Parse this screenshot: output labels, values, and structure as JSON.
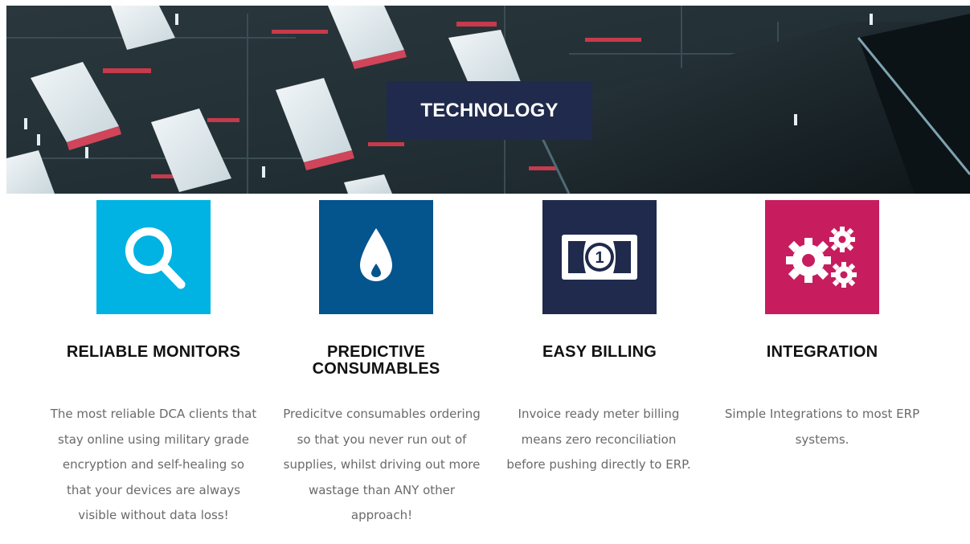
{
  "hero": {
    "title": "TECHNOLOGY"
  },
  "features": [
    {
      "title": "RELIABLE MONITORS",
      "icon": "search-icon",
      "color": "#00b3e3",
      "description": "The most reliable DCA clients that stay online using military grade encryption and self-healing so that your devices are always visible without data loss!"
    },
    {
      "title": "PREDICTIVE CONSUMABLES",
      "icon": "ink-drop-icon",
      "color": "#04548d",
      "description": "Predicitve consumables ordering so that you never run out of supplies, whilst driving out more wastage than ANY other approach!"
    },
    {
      "title": "EASY BILLING",
      "icon": "banknote-icon",
      "color": "#1f2a4c",
      "description": "Invoice ready meter billing means zero reconciliation before pushing directly to ERP."
    },
    {
      "title": "INTEGRATION",
      "icon": "gears-icon",
      "color": "#c71d5f",
      "description": "Simple Integrations to most ERP systems."
    }
  ],
  "banknote_label": "1"
}
